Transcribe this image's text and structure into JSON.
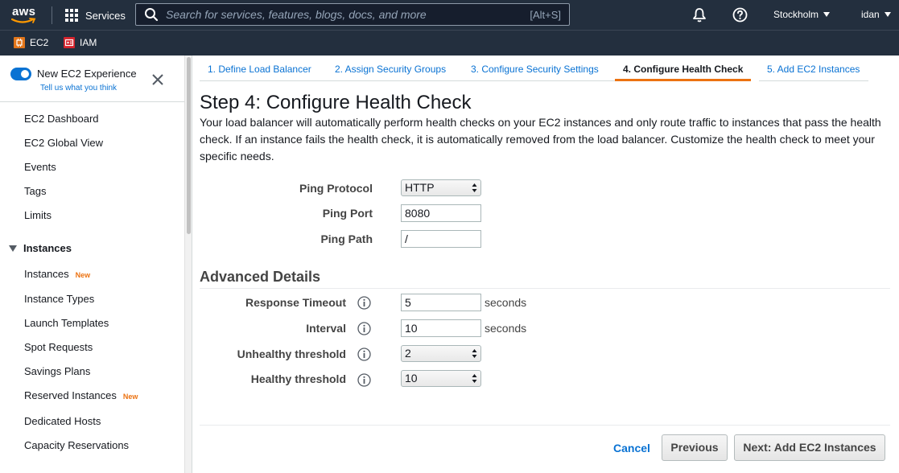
{
  "topnav": {
    "logo": "aws",
    "services_label": "Services",
    "search_placeholder": "Search for services, features, blogs, docs, and more",
    "search_shortcut": "[Alt+S]",
    "region": "Stockholm",
    "user": "idan",
    "icons": [
      "grid-icon",
      "search-icon",
      "bell-icon",
      "help-icon"
    ]
  },
  "favorites": [
    {
      "label": "EC2",
      "color": "#e2761b"
    },
    {
      "label": "IAM",
      "color": "#d6242d"
    }
  ],
  "sidebar": {
    "toggle_label": "New EC2 Experience",
    "toggle_on": true,
    "feedback_link": "Tell us what you think",
    "items": [
      {
        "label": "EC2 Dashboard"
      },
      {
        "label": "EC2 Global View"
      },
      {
        "label": "Events"
      },
      {
        "label": "Tags"
      },
      {
        "label": "Limits"
      }
    ],
    "section": {
      "label": "Instances",
      "items": [
        {
          "label": "Instances",
          "badge": "New"
        },
        {
          "label": "Instance Types"
        },
        {
          "label": "Launch Templates"
        },
        {
          "label": "Spot Requests"
        },
        {
          "label": "Savings Plans"
        },
        {
          "label": "Reserved Instances",
          "badge": "New"
        },
        {
          "label": "Dedicated Hosts"
        },
        {
          "label": "Capacity Reservations"
        }
      ]
    }
  },
  "wizard": {
    "tabs": [
      {
        "label": "1. Define Load Balancer",
        "active": false
      },
      {
        "label": "2. Assign Security Groups",
        "active": false
      },
      {
        "label": "3. Configure Security Settings",
        "active": false
      },
      {
        "label": "4. Configure Health Check",
        "active": true
      },
      {
        "label": "5. Add EC2 Instances",
        "active": false
      }
    ],
    "title": "Step 4: Configure Health Check",
    "description": "Your load balancer will automatically perform health checks on your EC2 instances and only route traffic to instances that pass the health check. If an instance fails the health check, it is automatically removed from the load balancer. Customize the health check to meet your specific needs."
  },
  "health_check": {
    "ping_protocol": {
      "label": "Ping Protocol",
      "value": "HTTP"
    },
    "ping_port": {
      "label": "Ping Port",
      "value": "8080"
    },
    "ping_path": {
      "label": "Ping Path",
      "value": "/"
    }
  },
  "advanced": {
    "title": "Advanced Details",
    "response_timeout": {
      "label": "Response Timeout",
      "value": "5",
      "unit": "seconds"
    },
    "interval": {
      "label": "Interval",
      "value": "10",
      "unit": "seconds"
    },
    "unhealthy_threshold": {
      "label": "Unhealthy threshold",
      "value": "2"
    },
    "healthy_threshold": {
      "label": "Healthy threshold",
      "value": "10"
    }
  },
  "footer": {
    "cancel": "Cancel",
    "previous": "Previous",
    "next": "Next: Add EC2 Instances"
  },
  "colors": {
    "nav_bg": "#232f3e",
    "link": "#0972d3",
    "active_tab_underline": "#ec7211",
    "badge_new": "#ec7211"
  }
}
